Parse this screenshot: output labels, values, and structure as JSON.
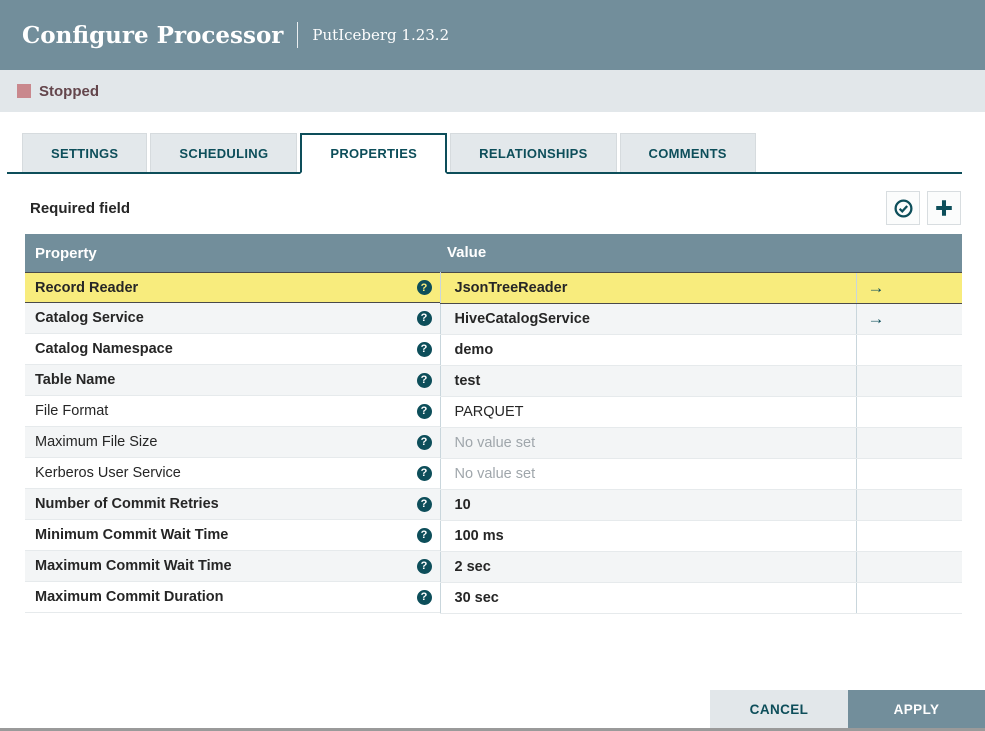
{
  "header": {
    "title": "Configure Processor",
    "subtitle": "PutIceberg 1.23.2"
  },
  "status": {
    "label": "Stopped"
  },
  "tabs": [
    {
      "label": "SETTINGS",
      "active": false
    },
    {
      "label": "SCHEDULING",
      "active": false
    },
    {
      "label": "PROPERTIES",
      "active": true
    },
    {
      "label": "RELATIONSHIPS",
      "active": false
    },
    {
      "label": "COMMENTS",
      "active": false
    }
  ],
  "toolbar": {
    "required_label": "Required field",
    "buttons": [
      {
        "icon": "check-circle",
        "name": "verify-properties-button"
      },
      {
        "icon": "plus",
        "name": "add-property-button"
      }
    ]
  },
  "table": {
    "columns": [
      "Property",
      "Value"
    ],
    "rows": [
      {
        "property": "Record Reader",
        "value": "JsonTreeReader",
        "required": true,
        "selected": true,
        "unset": false,
        "has_goto": true
      },
      {
        "property": "Catalog Service",
        "value": "HiveCatalogService",
        "required": true,
        "selected": false,
        "unset": false,
        "has_goto": true
      },
      {
        "property": "Catalog Namespace",
        "value": "demo",
        "required": true,
        "selected": false,
        "unset": false,
        "has_goto": false
      },
      {
        "property": "Table Name",
        "value": "test",
        "required": true,
        "selected": false,
        "unset": false,
        "has_goto": false
      },
      {
        "property": "File Format",
        "value": "PARQUET",
        "required": false,
        "selected": false,
        "unset": false,
        "has_goto": false
      },
      {
        "property": "Maximum File Size",
        "value": "No value set",
        "required": false,
        "selected": false,
        "unset": true,
        "has_goto": false
      },
      {
        "property": "Kerberos User Service",
        "value": "No value set",
        "required": false,
        "selected": false,
        "unset": true,
        "has_goto": false
      },
      {
        "property": "Number of Commit Retries",
        "value": "10",
        "required": true,
        "selected": false,
        "unset": false,
        "has_goto": false
      },
      {
        "property": "Minimum Commit Wait Time",
        "value": "100 ms",
        "required": true,
        "selected": false,
        "unset": false,
        "has_goto": false
      },
      {
        "property": "Maximum Commit Wait Time",
        "value": "2 sec",
        "required": true,
        "selected": false,
        "unset": false,
        "has_goto": false
      },
      {
        "property": "Maximum Commit Duration",
        "value": "30 sec",
        "required": true,
        "selected": false,
        "unset": false,
        "has_goto": false
      }
    ]
  },
  "footer": {
    "cancel_label": "CANCEL",
    "apply_label": "APPLY"
  },
  "colors": {
    "accent": "#0d4e5a",
    "slate": "#728e9b",
    "highlight": "#f8ec7d",
    "stopped": "#c9888d",
    "stopped-text": "#63454b",
    "stripe": "#f3f5f6",
    "unset-text": "#9fa6ab",
    "statusbar": "#e2e7ea"
  }
}
